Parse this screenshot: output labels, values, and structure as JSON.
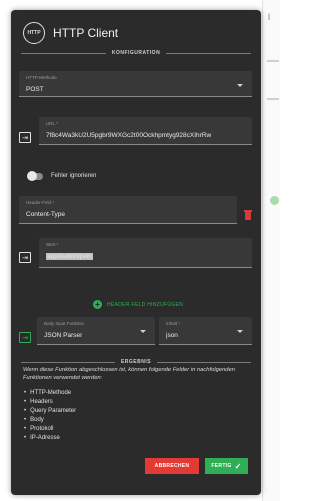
{
  "dialog": {
    "app_icon_label": "HTTP",
    "title": "HTTP Client"
  },
  "sections": {
    "configuration": "KONFIGURATION",
    "results": "ERGEBNIS"
  },
  "config": {
    "method_label": "HTTP-Methode",
    "method_value": "POST",
    "url_label": "URL *",
    "url_value": "7f8c4Wa3kU2U5pgbr9WXGc2t00Ockhpmtyg928cXIhrRw",
    "ignore_errors_label": "Fehler ignorieren",
    "header_field_label": "Header-Feld *",
    "header_field_value": "Content-Type",
    "value_label": "Wert *",
    "value_value": "application/json",
    "add_header_label": "HEADER-FELD HINZUFÜGEN",
    "body_label": "Body Input Funktion",
    "body_value": "JSON Parser",
    "content_label": "Inhalt *",
    "content_value": "json"
  },
  "results": {
    "description": "Wenn diese Funktion abgeschlossen ist, können folgende Felder in nachfolgenden Funktionen verwendet werden:",
    "items": [
      "HTTP-Methode",
      "Headers",
      "Query Parameter",
      "Body",
      "Protokoll",
      "IP-Adresse"
    ]
  },
  "buttons": {
    "cancel": "ABBRECHEN",
    "done": "FERTIG",
    "done_icon": "check-icon"
  },
  "colors": {
    "dialog_bg": "#2b2b2b",
    "accent_green": "#2fae55",
    "danger_red": "#e53935",
    "trash_red": "#d63c3c"
  }
}
